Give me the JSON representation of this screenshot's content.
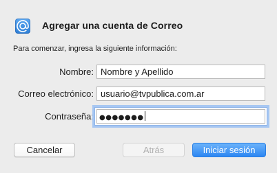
{
  "dialog": {
    "title": "Agregar una cuenta de Correo",
    "icon": "at-sign-icon",
    "intro": "Para comenzar, ingresa la siguiente información:"
  },
  "form": {
    "name_label": "Nombre:",
    "name_value": "Nombre y Apellido",
    "email_label": "Correo electrónico:",
    "email_value": "usuario@tvpublica.com.ar",
    "password_label": "Contraseña:",
    "password_value": "●●●●●●●"
  },
  "buttons": {
    "cancel": "Cancelar",
    "back": "Atrás",
    "sign_in": "Iniciar sesión"
  },
  "colors": {
    "window_bg": "#ececec",
    "accent": "#2c86f2",
    "focus_ring": "#a7c7f2",
    "disabled_text": "#b0b0b0"
  }
}
